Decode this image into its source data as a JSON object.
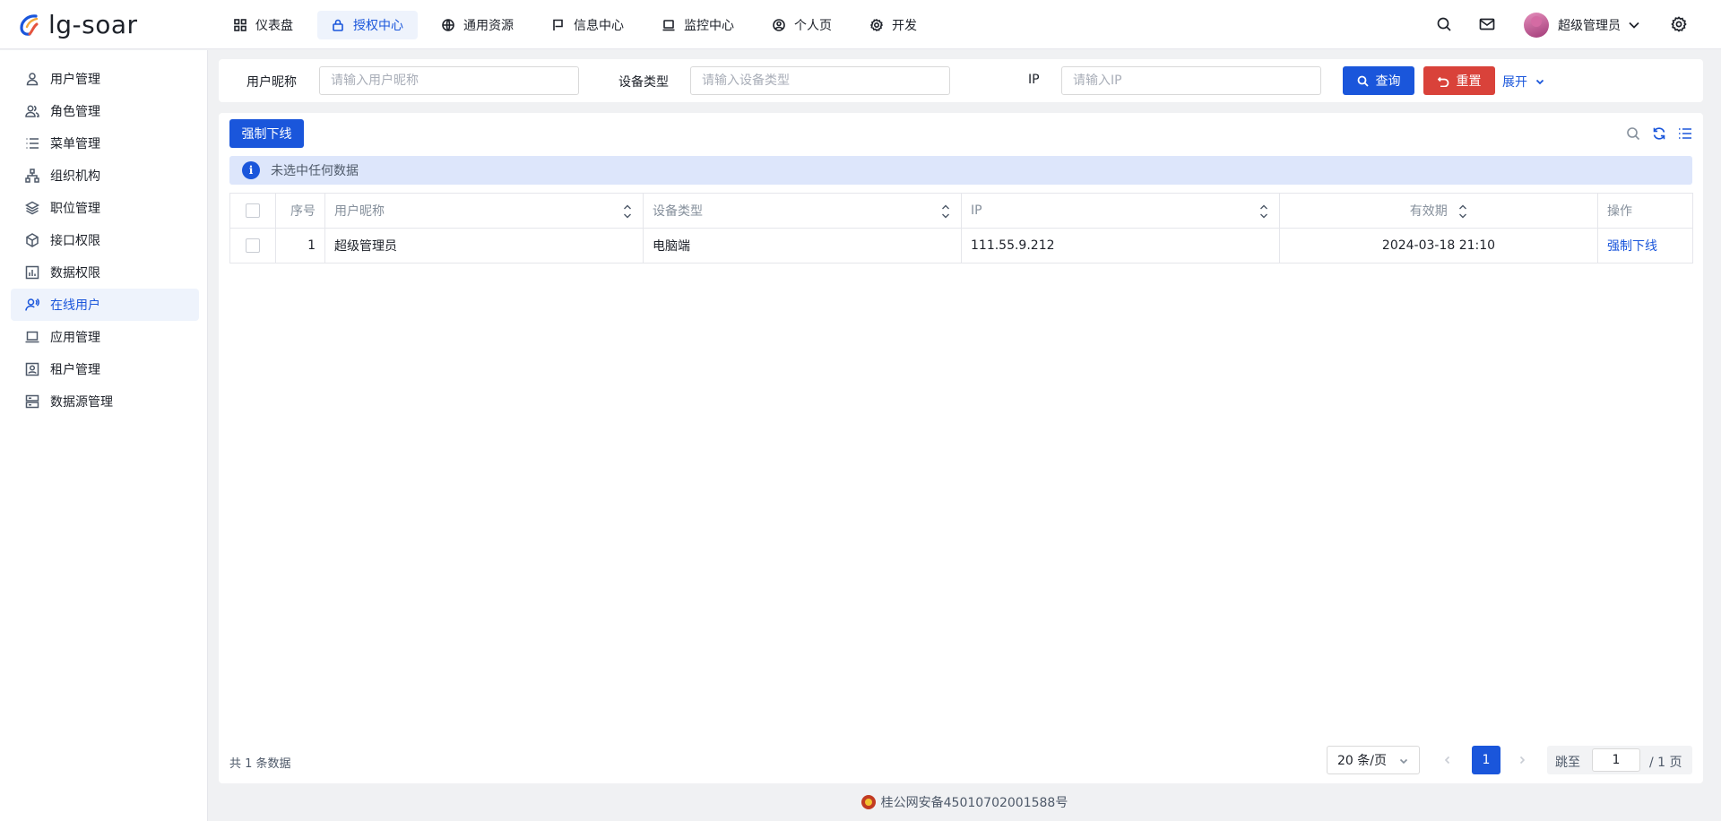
{
  "app": {
    "name": "lg-soar",
    "accent": "#1a56db",
    "danger": "#d9423a"
  },
  "topnav": [
    {
      "label": "仪表盘",
      "icon": "dashboard-icon"
    },
    {
      "label": "授权中心",
      "icon": "lock-icon",
      "active": true
    },
    {
      "label": "通用资源",
      "icon": "globe-icon"
    },
    {
      "label": "信息中心",
      "icon": "flag-icon"
    },
    {
      "label": "监控中心",
      "icon": "laptop-icon"
    },
    {
      "label": "个人页",
      "icon": "user-circle-icon"
    },
    {
      "label": "开发",
      "icon": "gear-icon"
    }
  ],
  "header": {
    "username": "超级管理员"
  },
  "sidebar": {
    "items": [
      {
        "label": "用户管理",
        "icon": "user-icon"
      },
      {
        "label": "角色管理",
        "icon": "users-icon"
      },
      {
        "label": "菜单管理",
        "icon": "list-icon"
      },
      {
        "label": "组织机构",
        "icon": "org-icon"
      },
      {
        "label": "职位管理",
        "icon": "layers-icon"
      },
      {
        "label": "接口权限",
        "icon": "cube-icon"
      },
      {
        "label": "数据权限",
        "icon": "bar-chart-icon"
      },
      {
        "label": "在线用户",
        "icon": "user-online-icon",
        "active": true
      },
      {
        "label": "应用管理",
        "icon": "laptop-icon"
      },
      {
        "label": "租户管理",
        "icon": "portrait-icon"
      },
      {
        "label": "数据源管理",
        "icon": "server-icon"
      }
    ]
  },
  "search": {
    "nickname_label": "用户昵称",
    "nickname_placeholder": "请输入用户昵称",
    "nickname_value": "",
    "device_label": "设备类型",
    "device_placeholder": "请输入设备类型",
    "device_value": "",
    "ip_label": "IP",
    "ip_placeholder": "请输入IP",
    "ip_value": "",
    "query_label": "查询",
    "reset_label": "重置",
    "expand_label": "展开"
  },
  "toolbar": {
    "force_offline_label": "强制下线"
  },
  "alert": {
    "info_glyph": "i",
    "text": "未选中任何数据"
  },
  "table": {
    "columns": [
      "序号",
      "用户昵称",
      "设备类型",
      "IP",
      "有效期",
      "操作"
    ],
    "rows": [
      {
        "index": "1",
        "nickname": "超级管理员",
        "device": "电脑端",
        "ip": "111.55.9.212",
        "expires": "2024-03-18 21:10",
        "action": "强制下线"
      }
    ]
  },
  "pagination": {
    "total_text": "共 1 条数据",
    "page_size": "20 条/页",
    "current_page": "1",
    "jump_label": "跳至",
    "jump_value": "1",
    "pages_text": "/ 1 页"
  },
  "footer": {
    "icp": "桂公网安备45010702001588号"
  }
}
